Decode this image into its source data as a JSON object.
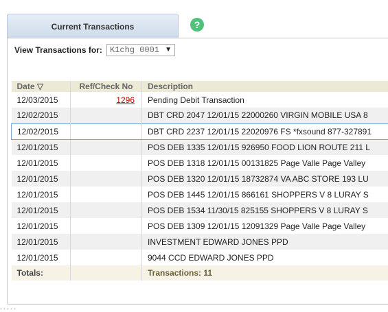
{
  "tab": {
    "label": "Current Transactions"
  },
  "help": {
    "label": "?"
  },
  "filter": {
    "label": "View Transactions for:",
    "selected": "K1chg 0001"
  },
  "table": {
    "headers": {
      "date": "Date ▽",
      "ref": "Ref/Check No",
      "desc": "Description"
    },
    "rows": [
      {
        "date": "12/03/2015",
        "ref": "1296",
        "desc": "Pending Debit Transaction"
      },
      {
        "date": "12/02/2015",
        "ref": "",
        "desc": "DBT CRD 2047 12/01/15 22000260 VIRGIN MOBILE USA 8"
      },
      {
        "date": "12/02/2015",
        "ref": "",
        "desc": "DBT CRD 2237 12/01/15 22020976 FS *fxsound 877-327891"
      },
      {
        "date": "12/01/2015",
        "ref": "",
        "desc": "POS DEB 1335 12/01/15 926950 FOOD LION ROUTE 211 L"
      },
      {
        "date": "12/01/2015",
        "ref": "",
        "desc": "POS DEB 1318 12/01/15 00131825 Page Valle Page Valley"
      },
      {
        "date": "12/01/2015",
        "ref": "",
        "desc": "POS DEB 1320 12/01/15 18732874 VA ABC STORE 193 LU"
      },
      {
        "date": "12/01/2015",
        "ref": "",
        "desc": "POS DEB 1445 12/01/15 866161 SHOPPERS V 8 LURAY S"
      },
      {
        "date": "12/01/2015",
        "ref": "",
        "desc": "POS DEB 1534 11/30/15 825155 SHOPPERS V 8 LURAY S"
      },
      {
        "date": "12/01/2015",
        "ref": "",
        "desc": "POS DEB 1309 12/01/15 12091329 Page Valle Page Valley"
      },
      {
        "date": "12/01/2015",
        "ref": "",
        "desc": "INVESTMENT EDWARD JONES PPD"
      },
      {
        "date": "12/01/2015",
        "ref": "",
        "desc": "9044 CCD EDWARD JONES PPD"
      }
    ],
    "footer": {
      "label": "Totals:",
      "count": "Transactions: 11"
    }
  }
}
